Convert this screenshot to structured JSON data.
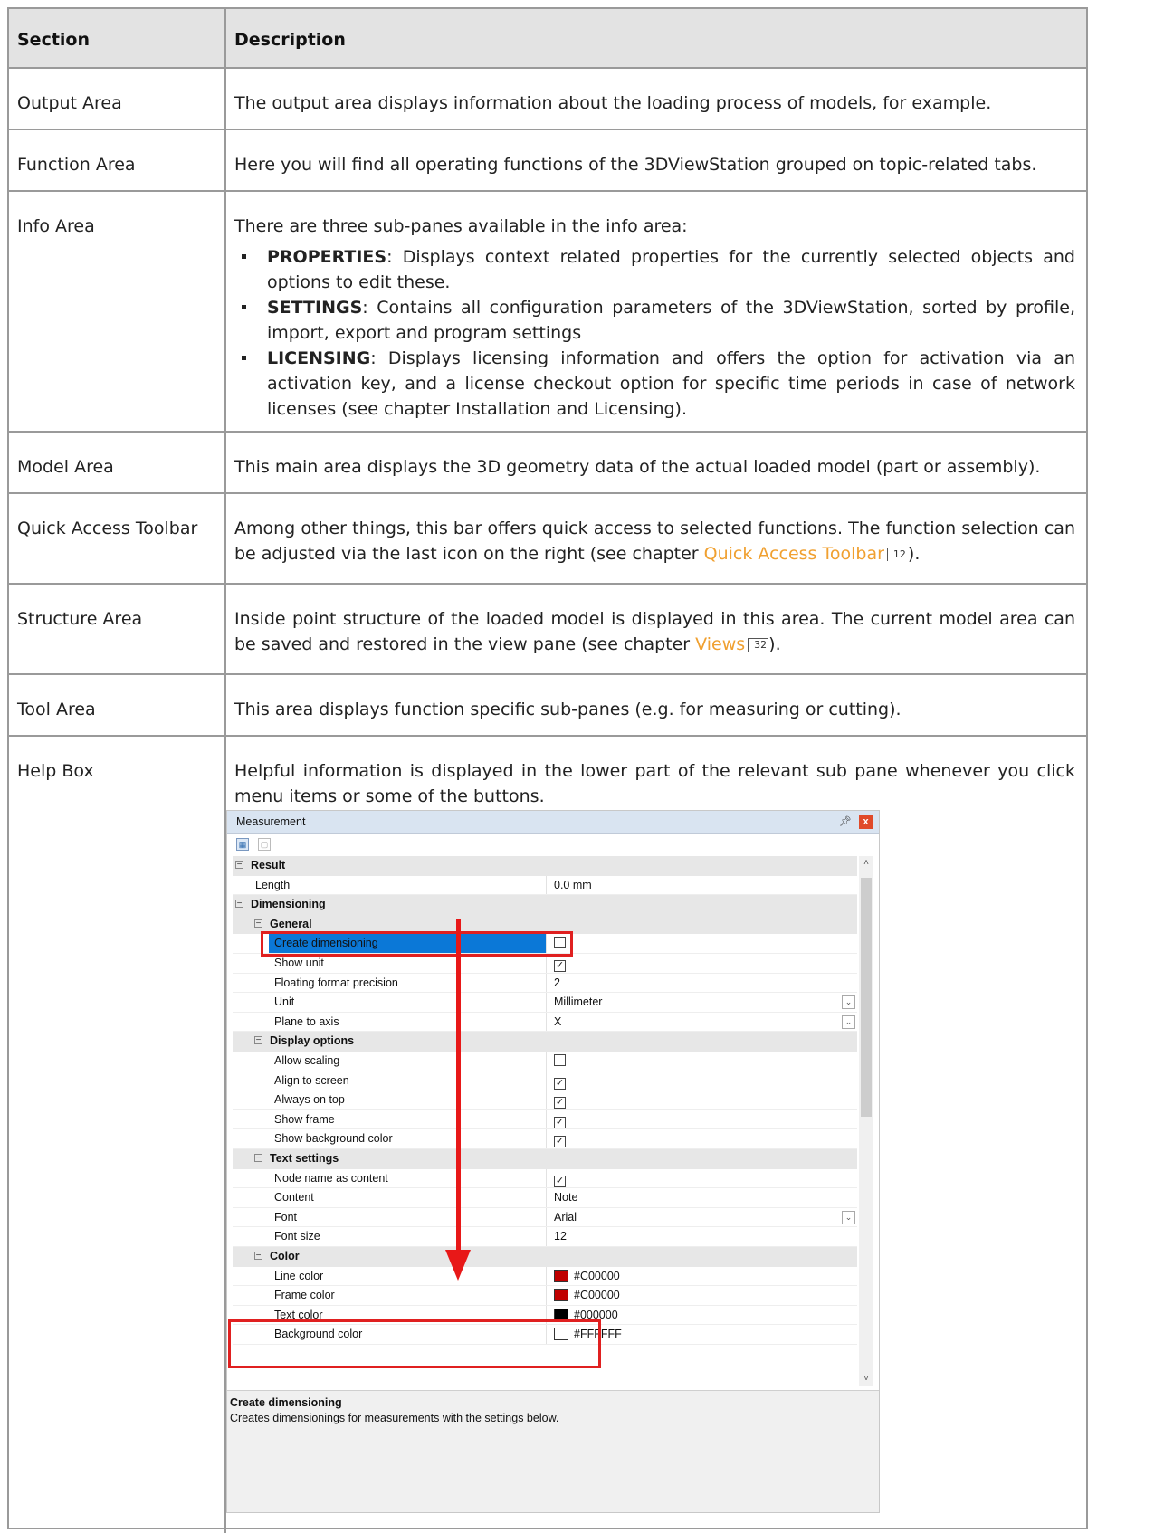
{
  "table": {
    "headers": [
      "Section",
      "Description"
    ],
    "rows": [
      {
        "section": "Output Area",
        "description": "The output area displays information about the loading process of models, for example."
      },
      {
        "section": "Function Area",
        "description": "Here you will find all operating functions of the 3DViewStation grouped on topic-related tabs."
      },
      {
        "section": "Info Area",
        "description": "There are three sub-panes available in the info area:",
        "bullets": [
          {
            "term": "PROPERTIES",
            "text": ": Displays context related properties for the currently selected objects and options to edit these."
          },
          {
            "term": "SETTINGS",
            "text": ": Contains all configuration parameters of the 3DViewStation, sorted by profile, import, export and program settings"
          },
          {
            "term": "LICENSING",
            "text": ": Displays licensing information and offers the option for activation via an activation key, and a license checkout option for specific time periods in case of network licenses (see chapter Installation and Licensing)."
          }
        ]
      },
      {
        "section": "Model Area",
        "description": "This main area displays the 3D geometry data of the actual loaded model (part or assembly)."
      },
      {
        "section": "Quick Access Toolbar",
        "description_before": "Among other things, this bar offers quick access to selected functions. The function selection can be adjusted via the last icon on the right (see chapter ",
        "link": "Quick Access Toolbar",
        "page": "12",
        "description_after": ")."
      },
      {
        "section": "Structure Area",
        "description_before": "Inside point structure of the loaded model is displayed in this area. The current model area can be saved and restored in the view pane (see chapter ",
        "link": "Views",
        "page": "32",
        "description_after": ")."
      },
      {
        "section": "Tool Area",
        "description": "This area displays function specific sub-panes (e.g. for measuring or cutting)."
      },
      {
        "section": "Help Box",
        "description": "Helpful information is displayed in the lower part of the relevant sub pane whenever you click menu items or some of the buttons."
      }
    ]
  },
  "panel": {
    "title": "Measurement",
    "pin_icon": "pin-icon",
    "close_icon": "close-icon",
    "rows": [
      {
        "kind": "cat",
        "level": 0,
        "name": "Result"
      },
      {
        "kind": "item",
        "level": 1,
        "name": "Length",
        "value": "0.0 mm"
      },
      {
        "kind": "cat",
        "level": 0,
        "name": "Dimensioning"
      },
      {
        "kind": "cat",
        "level": 1,
        "name": "General"
      },
      {
        "kind": "item",
        "level": 2,
        "name": "Create dimensioning",
        "check": false,
        "selected": true
      },
      {
        "kind": "item",
        "level": 2,
        "name": "Show unit",
        "check": true
      },
      {
        "kind": "item",
        "level": 2,
        "name": "Floating format precision",
        "value": "2"
      },
      {
        "kind": "item",
        "level": 2,
        "name": "Unit",
        "value": "Millimeter",
        "dropdown": true
      },
      {
        "kind": "item",
        "level": 2,
        "name": "Plane to axis",
        "value": "X",
        "dropdown": true
      },
      {
        "kind": "cat",
        "level": 1,
        "name": "Display options"
      },
      {
        "kind": "item",
        "level": 2,
        "name": "Allow scaling",
        "check": false
      },
      {
        "kind": "item",
        "level": 2,
        "name": "Align to screen",
        "check": true
      },
      {
        "kind": "item",
        "level": 2,
        "name": "Always on top",
        "check": true
      },
      {
        "kind": "item",
        "level": 2,
        "name": "Show frame",
        "check": true
      },
      {
        "kind": "item",
        "level": 2,
        "name": "Show background color",
        "check": true
      },
      {
        "kind": "cat",
        "level": 1,
        "name": "Text settings"
      },
      {
        "kind": "item",
        "level": 2,
        "name": "Node name as content",
        "check": true
      },
      {
        "kind": "item",
        "level": 2,
        "name": "Content",
        "value": "Note"
      },
      {
        "kind": "item",
        "level": 2,
        "name": "Font",
        "value": "Arial",
        "dropdown": true
      },
      {
        "kind": "item",
        "level": 2,
        "name": "Font size",
        "value": "12"
      },
      {
        "kind": "cat",
        "level": 1,
        "name": "Color"
      },
      {
        "kind": "item",
        "level": 2,
        "name": "Line color",
        "value": "#C00000",
        "swatch": "#c00000"
      },
      {
        "kind": "item",
        "level": 2,
        "name": "Frame color",
        "value": "#C00000",
        "swatch": "#c00000"
      },
      {
        "kind": "item",
        "level": 2,
        "name": "Text color",
        "value": "#000000",
        "swatch": "#000000"
      },
      {
        "kind": "item",
        "level": 2,
        "name": "Background color",
        "value": "#FFFFFF",
        "swatch": "#ffffff"
      }
    ],
    "help": {
      "title": "Create dimensioning",
      "text": "Creates dimensionings for measurements with the settings below."
    },
    "highlight_color": "#e02020",
    "selection_color": "#0b78d7"
  }
}
